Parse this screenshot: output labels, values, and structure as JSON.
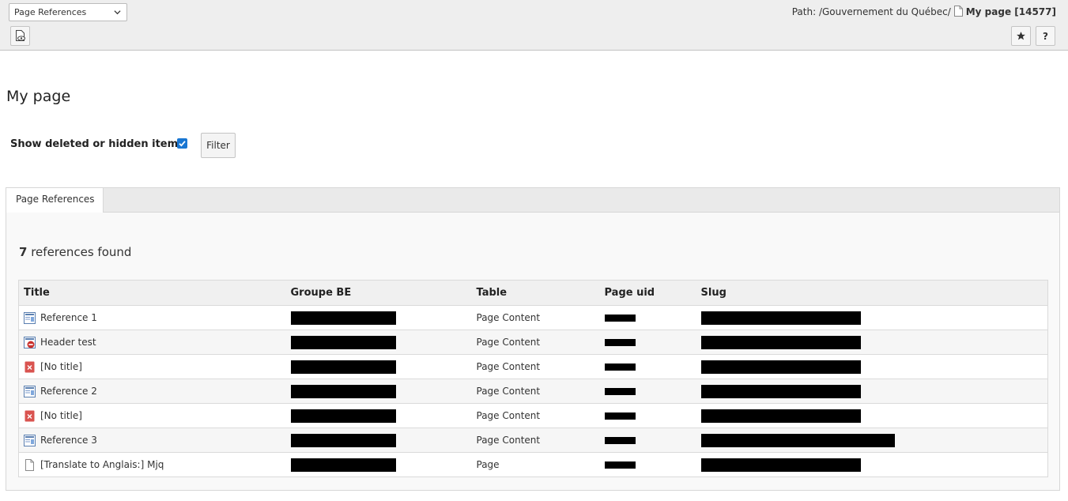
{
  "docheader": {
    "module_select": {
      "value": "Page References"
    },
    "path": {
      "label": "Path: /Gouvernement du Québec/",
      "current_page": "My page [14577]"
    },
    "buttons": {
      "view_icon": "view-page-icon",
      "bookmark_icon": "star-icon",
      "help_label": "?"
    }
  },
  "page": {
    "title": "My page",
    "filter": {
      "label": "Show deleted or hidden items",
      "checked": true,
      "button_label": "Filter"
    },
    "tabs": [
      {
        "label": "Page References",
        "active": true
      }
    ],
    "references": {
      "count": "7",
      "count_suffix": "references found",
      "columns": [
        "Title",
        "Groupe BE",
        "Table",
        "Page uid",
        "Slug"
      ],
      "rows": [
        {
          "icon": "content-element-icon",
          "title": "Reference 1",
          "table": "Page Content"
        },
        {
          "icon": "content-hidden-icon",
          "title": "Header test",
          "table": "Page Content"
        },
        {
          "icon": "content-deleted-icon",
          "title": "[No title]",
          "table": "Page Content"
        },
        {
          "icon": "content-element-icon",
          "title": "Reference 2",
          "table": "Page Content"
        },
        {
          "icon": "content-deleted-icon",
          "title": "[No title]",
          "table": "Page Content"
        },
        {
          "icon": "content-element-icon",
          "title": "Reference 3",
          "table": "Page Content"
        },
        {
          "icon": "page-icon",
          "title": "[Translate to Anglais:] Mjq",
          "table": "Page"
        }
      ]
    }
  },
  "colors": {
    "redaction": "#000000",
    "checkbox": "#1976d2",
    "deleted": "#d9534f"
  }
}
